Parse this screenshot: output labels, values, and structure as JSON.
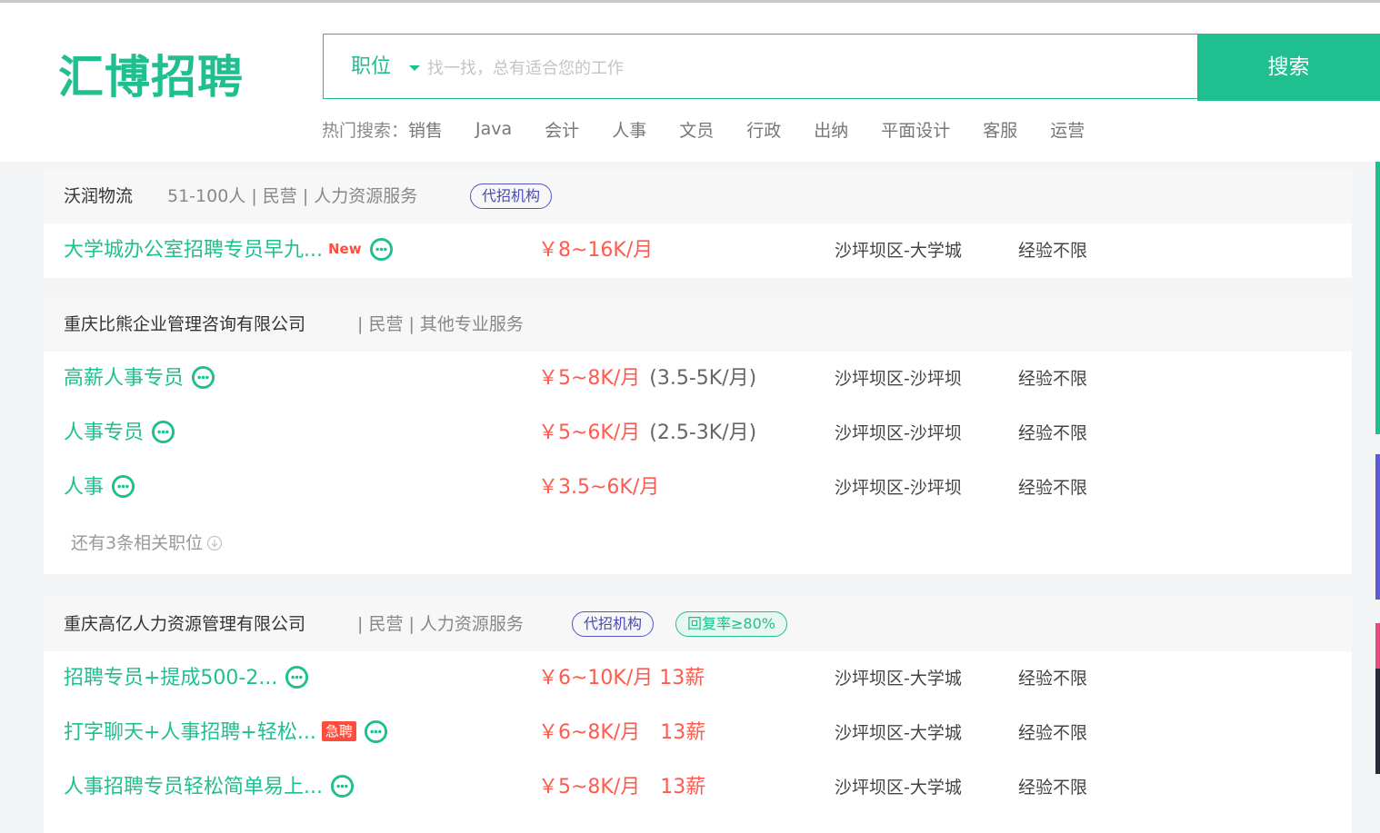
{
  "header": {
    "logo": "汇博招聘",
    "search": {
      "type_label": "职位",
      "placeholder": "找一找，总有适合您的工作",
      "button_label": "搜索"
    },
    "hot_search": {
      "label": "热门搜索：",
      "items": [
        "销售",
        "Java",
        "会计",
        "人事",
        "文员",
        "行政",
        "出纳",
        "平面设计",
        "客服",
        "运营"
      ]
    }
  },
  "companies": [
    {
      "name": "沃润物流",
      "meta": "51-100人 | 民营 | 人力资源服务",
      "tags": [
        "代招机构"
      ],
      "jobs": [
        {
          "title": "大学城办公室招聘专员早九...",
          "new_label": "New",
          "salary": "￥8~16K/月",
          "salary_note": "",
          "location": "沙坪坝区-大学城",
          "experience": "经验不限"
        }
      ]
    },
    {
      "name": "重庆比熊企业管理咨询有限公司",
      "meta": "| 民营 | 其他专业服务",
      "tags": [],
      "jobs": [
        {
          "title": "高薪人事专员",
          "salary": "￥5~8K/月",
          "salary_note": "(3.5-5K/月)",
          "location": "沙坪坝区-沙坪坝",
          "experience": "经验不限"
        },
        {
          "title": "人事专员",
          "salary": "￥5~6K/月",
          "salary_note": "(2.5-3K/月)",
          "location": "沙坪坝区-沙坪坝",
          "experience": "经验不限"
        },
        {
          "title": "人事",
          "salary": "￥3.5~6K/月",
          "salary_note": "",
          "location": "沙坪坝区-沙坪坝",
          "experience": "经验不限"
        }
      ],
      "more_label": "还有3条相关职位"
    },
    {
      "name": "重庆高亿人力资源管理有限公司",
      "meta": "| 民营 | 人力资源服务",
      "tags": [
        "代招机构",
        "回复率≥80%"
      ],
      "jobs": [
        {
          "title": "招聘专员+提成500-2...",
          "salary": "￥6~10K/月 13薪",
          "salary_note": "",
          "location": "沙坪坝区-大学城",
          "experience": "经验不限"
        },
        {
          "title": "打字聊天+人事招聘+轻松...",
          "urgent_label": "急聘",
          "salary": "￥6~8K/月　13薪",
          "salary_note": "",
          "location": "沙坪坝区-大学城",
          "experience": "经验不限"
        },
        {
          "title": "人事招聘专员轻松简单易上...",
          "salary": "￥5~8K/月　13薪",
          "salary_note": "",
          "location": "沙坪坝区-大学城",
          "experience": "经验不限"
        }
      ]
    }
  ],
  "colors": {
    "brand": "#1fbf8f",
    "salary": "#ff5a4e",
    "agency_tag": "#4a49b8",
    "urgent": "#ff4d3d"
  },
  "icons": {
    "chat": "chat-bubble-icon",
    "more": "circle-arrow-down-icon",
    "dropdown": "caret-down-icon"
  }
}
